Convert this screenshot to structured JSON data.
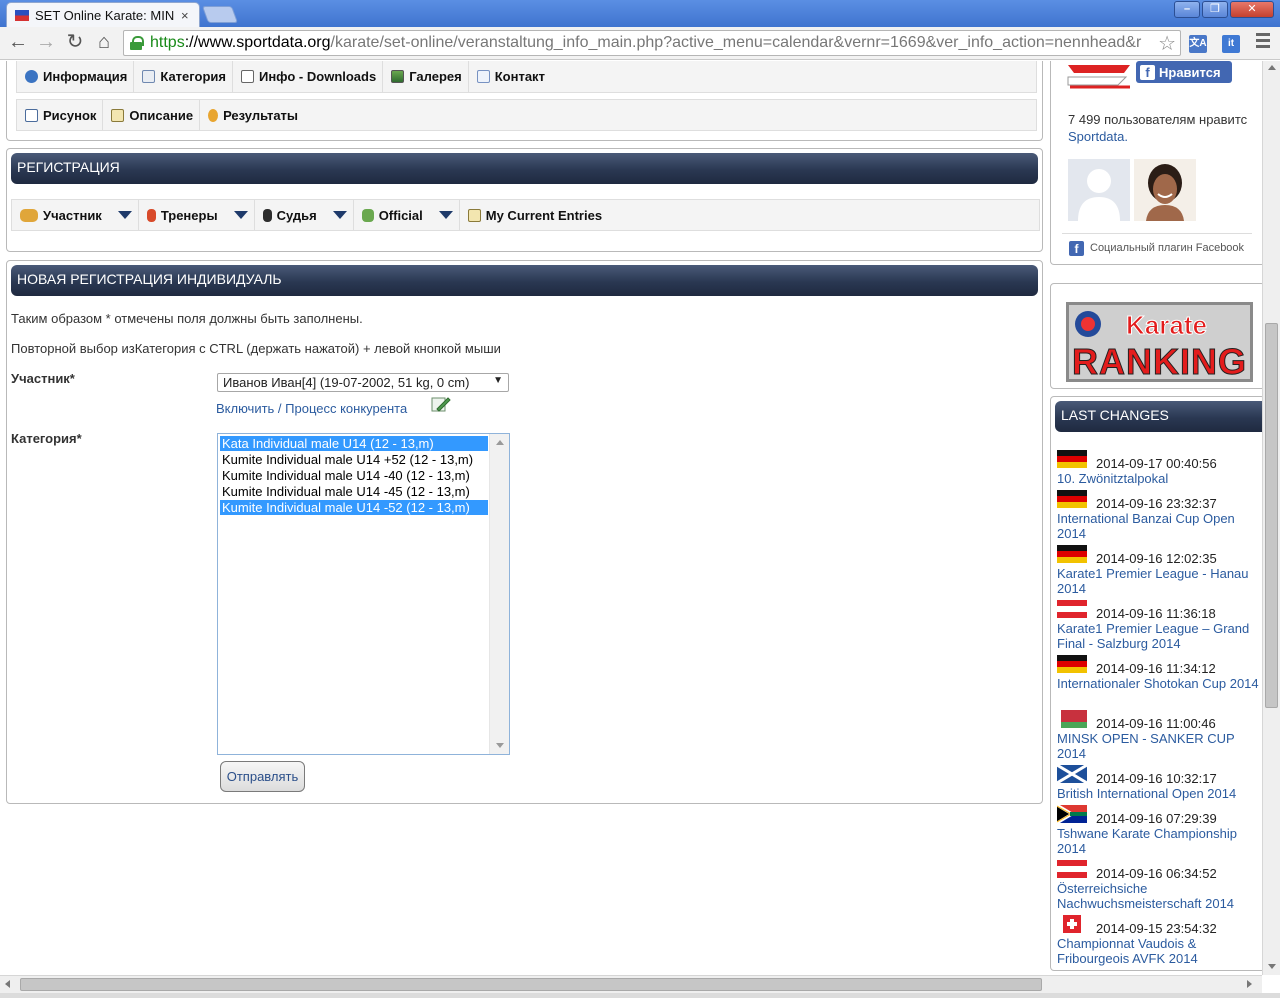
{
  "browser": {
    "tab_title": "SET Online Karate: MIN",
    "tab_close": "×",
    "url_https": "https",
    "url_host": "://www.sportdata.org",
    "url_path": "/karate/set-online/veranstaltung_info_main.php?active_menu=calendar&vernr=1669&ver_info_action=nennhead&r",
    "ext_translate": "文A",
    "ext_it": "it"
  },
  "event_menu": {
    "row1": [
      {
        "label": "Информация",
        "icon": "info-icon"
      },
      {
        "label": "Категория",
        "icon": "folder-icon"
      },
      {
        "label": "Инфо - Downloads",
        "icon": "document-icon"
      },
      {
        "label": "Галерея",
        "icon": "gallery-icon"
      },
      {
        "label": "Контакт",
        "icon": "mail-icon"
      }
    ],
    "row2": [
      {
        "label": "Рисунок",
        "icon": "draw-icon"
      },
      {
        "label": "Описание",
        "icon": "description-icon"
      },
      {
        "label": "Результаты",
        "icon": "medal-icon"
      }
    ]
  },
  "registration": {
    "header": "РЕГИСТРАЦИЯ",
    "menu": [
      {
        "label": "Участник",
        "icon": "participants-icon"
      },
      {
        "label": "Тренеры",
        "icon": "coach-icon"
      },
      {
        "label": "Судья",
        "icon": "judge-icon"
      },
      {
        "label": "Official",
        "icon": "official-icon"
      },
      {
        "label": "My Current Entries",
        "icon": "entries-icon"
      }
    ]
  },
  "form": {
    "header": "НОВАЯ РЕГИСТРАЦИЯ ИНДИВИДУАЛЬ",
    "note_required": "Таким образом * отмечены поля должны быть заполнены.",
    "note_multiselect": "Повторной выбор изКатегория с CTRL (держать нажатой) + левой кнопкой мыши",
    "participant_label": "Участник*",
    "participant_value": "Иванов Иван[4] (19-07-2002, 51 kg, 0 cm)",
    "include_link": "Включить / Процесс конкурента",
    "category_label": "Категория*",
    "categories": [
      {
        "label": "Kata Individual male U14 (12 - 13,m)",
        "selected": true
      },
      {
        "label": "Kumite Individual male U14 +52 (12 - 13,m)",
        "selected": false
      },
      {
        "label": "Kumite Individual male U14 -40 (12 - 13,m)",
        "selected": false
      },
      {
        "label": "Kumite Individual male U14 -45 (12 - 13,m)",
        "selected": false
      },
      {
        "label": "Kumite Individual male U14 -52 (12 - 13,m)",
        "selected": true
      }
    ],
    "submit_label": "Отправлять"
  },
  "sidebar": {
    "fb_like": "Нравится",
    "fb_count_text": "7 499 пользователям нравитс",
    "fb_page": "Sportdata.",
    "fb_plugin": "Социальный плагин Facebook",
    "ranking_line1": "Karate",
    "ranking_line2": "RANKING",
    "last_changes_header": "LAST CHANGES",
    "last_changes": [
      {
        "timestamp": "2014-09-17 00:40:56",
        "title": "10. Zwönitztalpokal",
        "flag": "germany"
      },
      {
        "timestamp": "2014-09-16 23:32:37",
        "title": "International Banzai Cup Open 2014",
        "flag": "germany"
      },
      {
        "timestamp": "2014-09-16 12:02:35",
        "title": "Karate1 Premier League - Hanau 2014",
        "flag": "germany"
      },
      {
        "timestamp": "2014-09-16 11:36:18",
        "title": "Karate1 Premier League – Grand Final - Salzburg 2014",
        "flag": "austria"
      },
      {
        "timestamp": "2014-09-16 11:34:12",
        "title": "Internationaler Shotokan Cup 2014",
        "flag": "germany"
      },
      {
        "timestamp": "2014-09-16 11:00:46",
        "title": "MINSK OPEN - SANKER CUP 2014",
        "flag": "belarus"
      },
      {
        "timestamp": "2014-09-16 10:32:17",
        "title": "British International Open 2014",
        "flag": "scotland"
      },
      {
        "timestamp": "2014-09-16 07:29:39",
        "title": "Tshwane Karate Championship 2014",
        "flag": "south-africa"
      },
      {
        "timestamp": "2014-09-16 06:34:52",
        "title": "Österreichsiche Nachwuchsmeisterschaft 2014",
        "flag": "austria"
      },
      {
        "timestamp": "2014-09-15 23:54:32",
        "title": "Championnat Vaudois & Fribourgeois AVFK 2014",
        "flag": "switzerland"
      }
    ]
  }
}
